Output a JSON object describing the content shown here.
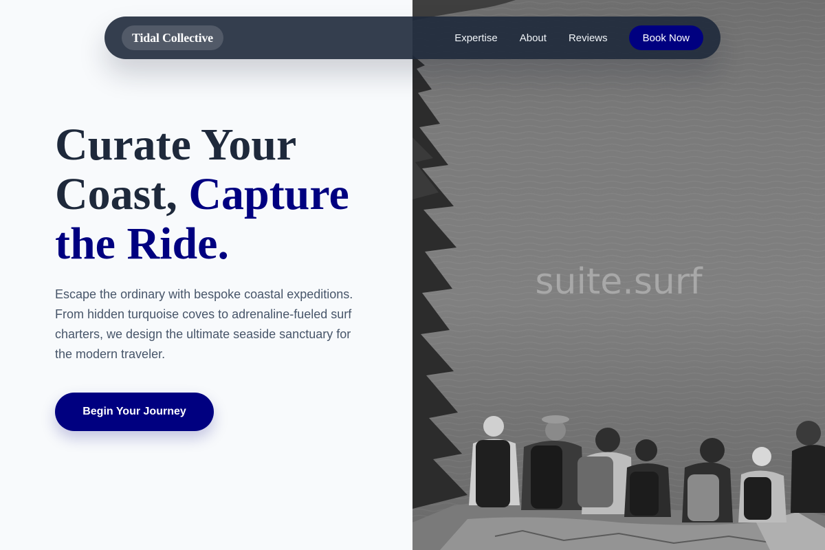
{
  "nav": {
    "brand": "Tidal Collective",
    "links": [
      "Expertise",
      "About",
      "Reviews"
    ],
    "cta": "Book Now"
  },
  "hero": {
    "headline_line1": "Curate Your",
    "headline_line2_plain": "Coast, ",
    "headline_line2_accent": "Capture",
    "headline_line3": "the Ride.",
    "description": "Escape the ordinary with bespoke coastal expeditions. From hidden turquoise coves to adrenaline-fueled surf charters, we design the ultimate seaside sanctuary for the modern traveler.",
    "cta": "Begin Your Journey"
  },
  "photo": {
    "watermark": "suite.surf"
  },
  "colors": {
    "accent": "#000080",
    "nav_bg": "#1e293b",
    "heading": "#1e293b",
    "body_text": "#475569",
    "page_bg": "#f8fafc"
  }
}
